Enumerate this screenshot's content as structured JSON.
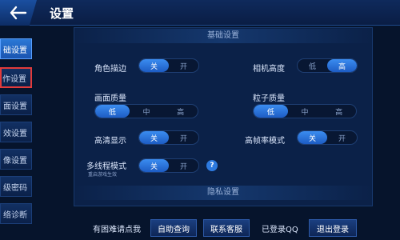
{
  "header": {
    "title": "设置"
  },
  "sidebar": {
    "items": [
      {
        "label": "础设置"
      },
      {
        "label": "作设置"
      },
      {
        "label": "面设置"
      },
      {
        "label": "效设置"
      },
      {
        "label": "像设置"
      },
      {
        "label": "级密码"
      },
      {
        "label": "络诊断"
      }
    ]
  },
  "sections": {
    "basic": "基础设置",
    "privacy": "隐私设置"
  },
  "settings": {
    "outline": {
      "label": "角色描边",
      "options": [
        "关",
        "开"
      ],
      "selected": "关"
    },
    "camera_height": {
      "label": "相机高度",
      "options": [
        "低",
        "高"
      ],
      "selected": "高"
    },
    "quality": {
      "label": "画面质量",
      "options": [
        "低",
        "中",
        "高"
      ],
      "selected": "低"
    },
    "particle": {
      "label": "粒子质量",
      "options": [
        "低",
        "中",
        "高"
      ],
      "selected": "低"
    },
    "hd": {
      "label": "高清显示",
      "options": [
        "关",
        "开"
      ],
      "selected": "关"
    },
    "high_fps": {
      "label": "高帧率模式",
      "options": [
        "关",
        "开"
      ],
      "selected": "关"
    },
    "multithread": {
      "label": "多线程模式",
      "sublabel": "重启游戏生效",
      "options": [
        "关",
        "开"
      ],
      "selected": "关"
    }
  },
  "help_icon": "?",
  "bottom": {
    "prompt": "有困难请点我",
    "self_query": "自助查询",
    "contact": "联系客服",
    "logged_in": "已登录QQ",
    "logout": "退出登录"
  },
  "colors": {
    "accent": "#2d7ae0",
    "background": "#06142c",
    "highlight_border": "#e23b3b"
  }
}
